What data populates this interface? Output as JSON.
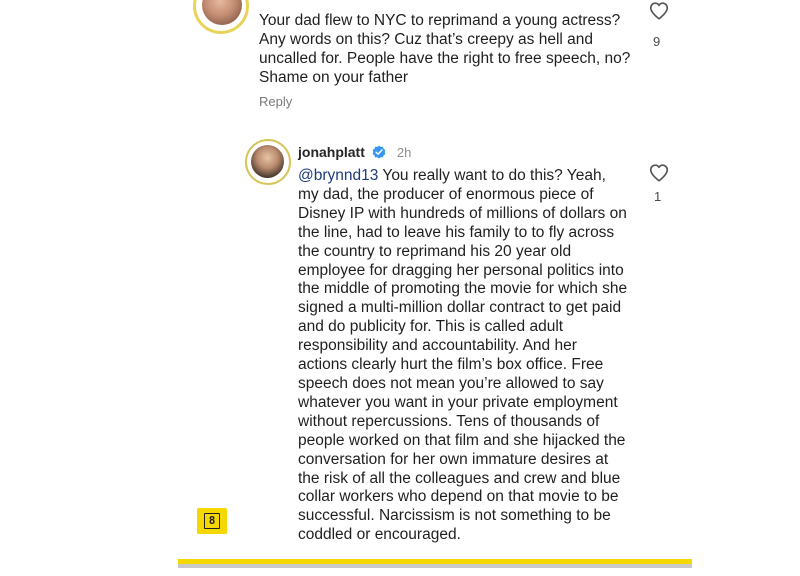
{
  "comment1": {
    "text": "Your dad flew to NYC to reprimand a young actress? Any words on this? Cuz that’s creepy as hell and uncalled for. People have the right to free speech, no? Shame on your father",
    "reply_label": "Reply",
    "like_count": "9"
  },
  "reply": {
    "username": "jonahplatt",
    "timestamp": "2h",
    "mention": "@brynnd13",
    "text": " You really want to do this? Yeah, my dad, the producer of enormous piece of Disney IP with hundreds of millions of dollars on the line, had to leave his family to to fly across the country to reprimand his 20 year old employee for dragging her personal politics into the middle of promoting the movie for which she signed a multi-million dollar contract to get paid and do publicity for. This is called adult responsibility and accountability. And her actions clearly hurt the film’s box office. Free speech does not mean you’re allowed to say whatever you want in your private employment without repercussions. Tens of thousands of people worked on that film and she hijacked the conversation for her own immature desires at the risk of all the colleagues and crew and blue collar workers who depend on that movie to be successful. Narcissism is not something to be coddled or encouraged.",
    "like_count": "1"
  },
  "watermark": {
    "label": "8"
  },
  "colors": {
    "verified_blue": "#3897f0",
    "accent_yellow": "#f5d800"
  },
  "icons": {
    "like": "heart-outline-icon",
    "verified": "verified-badge-icon"
  }
}
